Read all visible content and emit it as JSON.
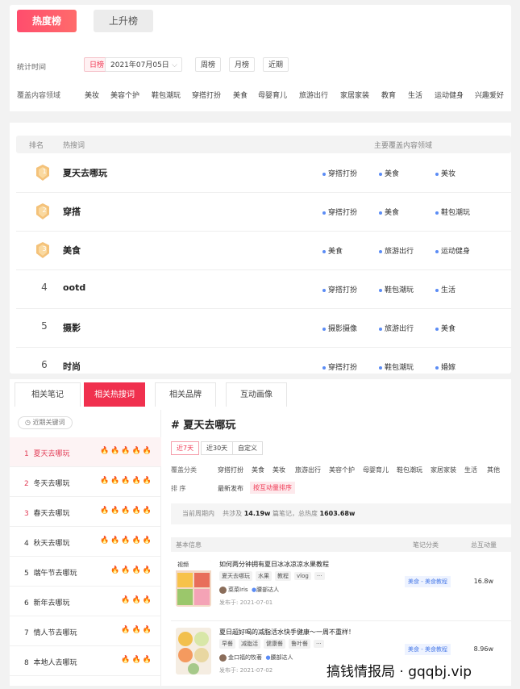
{
  "ranking": {
    "tabs": [
      "热度榜",
      "上升榜"
    ],
    "stat_time_label": "统计时间",
    "period_chips": [
      "日榜",
      "周榜",
      "月榜",
      "近期"
    ],
    "date_value": "2021年07月05日",
    "coverage_label": "覆盖内容领域",
    "categories": [
      "美妆",
      "美容个护",
      "鞋包潮玩",
      "穿搭打扮",
      "美食",
      "母婴育儿",
      "旅游出行",
      "家居家装",
      "教育",
      "生活",
      "运动健身",
      "兴趣爱好"
    ],
    "table_headers": {
      "rank": "排名",
      "keyword": "热搜词",
      "domains": "主要覆盖内容领域"
    },
    "rows": [
      {
        "rank": "1",
        "keyword": "夏天去哪玩",
        "tags": [
          "穿搭打扮",
          "美食",
          "美妆"
        ]
      },
      {
        "rank": "2",
        "keyword": "穿搭",
        "tags": [
          "穿搭打扮",
          "美食",
          "鞋包潮玩"
        ]
      },
      {
        "rank": "3",
        "keyword": "美食",
        "tags": [
          "美食",
          "旅游出行",
          "运动健身"
        ]
      },
      {
        "rank": "4",
        "keyword": "ootd",
        "tags": [
          "穿搭打扮",
          "鞋包潮玩",
          "生活"
        ]
      },
      {
        "rank": "5",
        "keyword": "摄影",
        "tags": [
          "摄影摄像",
          "旅游出行",
          "美食"
        ]
      },
      {
        "rank": "6",
        "keyword": "时尚",
        "tags": [
          "穿搭打扮",
          "鞋包潮玩",
          "婚嫁"
        ]
      }
    ]
  },
  "detail": {
    "tabs": [
      "相关笔记",
      "相关热搜词",
      "相关品牌",
      "互动画像"
    ],
    "recent_label": "近期关键词",
    "keywords": [
      {
        "num": "1",
        "text": "夏天去哪玩",
        "flames": "🔥🔥🔥🔥🔥",
        "hot": true
      },
      {
        "num": "2",
        "text": "冬天去哪玩",
        "flames": "🔥🔥🔥🔥🔥",
        "hot": true
      },
      {
        "num": "3",
        "text": "春天去哪玩",
        "flames": "🔥🔥🔥🔥🔥",
        "hot": true
      },
      {
        "num": "4",
        "text": "秋天去哪玩",
        "flames": "🔥🔥🔥🔥🔥",
        "hot": false
      },
      {
        "num": "5",
        "text": "端午节去哪玩",
        "flames": "🔥🔥🔥🔥",
        "hot": false
      },
      {
        "num": "6",
        "text": "新年去哪玩",
        "flames": "🔥🔥🔥",
        "hot": false
      },
      {
        "num": "7",
        "text": "情人节去哪玩",
        "flames": "🔥🔥🔥",
        "hot": false
      },
      {
        "num": "8",
        "text": "本地人去哪玩",
        "flames": "🔥🔥🔥",
        "hot": false
      }
    ],
    "title": "# 夏天去哪玩",
    "range_chips": [
      "近7天",
      "近30天",
      "自定义"
    ],
    "cover_label": "覆盖分类",
    "cover_categories": [
      "穿搭打扮",
      "美食",
      "美妆",
      "旅游出行",
      "美容个护",
      "母婴育儿",
      "鞋包潮玩",
      "家居家装",
      "生活",
      "其他"
    ],
    "sort_label": "排   序",
    "sort_options": [
      "最新发布",
      "按互动量排序"
    ],
    "stat_prefix": "当前周期内",
    "stat_text1": "共涉及",
    "stat_notes": "14.19w",
    "stat_text2": "篇笔记，总热度",
    "stat_heat": "1603.68w",
    "table_headers": {
      "basic": "基本信息",
      "category": "笔记分类",
      "interaction": "总互动量"
    },
    "posts": [
      {
        "title": "如何两分钟拥有夏日冰冰凉凉水果教程",
        "tags": [
          "夏天去哪玩",
          "水果",
          "教程",
          "vlog",
          "···"
        ],
        "author": "菜菜Iris",
        "badge": "腰部达人",
        "time": "发布于: 2021-07-01",
        "category": "美食 - 美食教程",
        "interactions": "16.8w",
        "thumb_label": "视频"
      },
      {
        "title": "夏日超好喝的减脂活水快手健康～一周不重样！",
        "tags": [
          "早餐",
          "减脂活",
          "健康餐",
          "鲁叶餐",
          "···"
        ],
        "author": "金口福的牧著",
        "badge": "腰部达人",
        "time": "发布于: 2021-07-02",
        "category": "美食 - 美食教程",
        "interactions": "8.96w"
      }
    ]
  },
  "watermark": "搞钱情报局 · gqqbj.vip"
}
